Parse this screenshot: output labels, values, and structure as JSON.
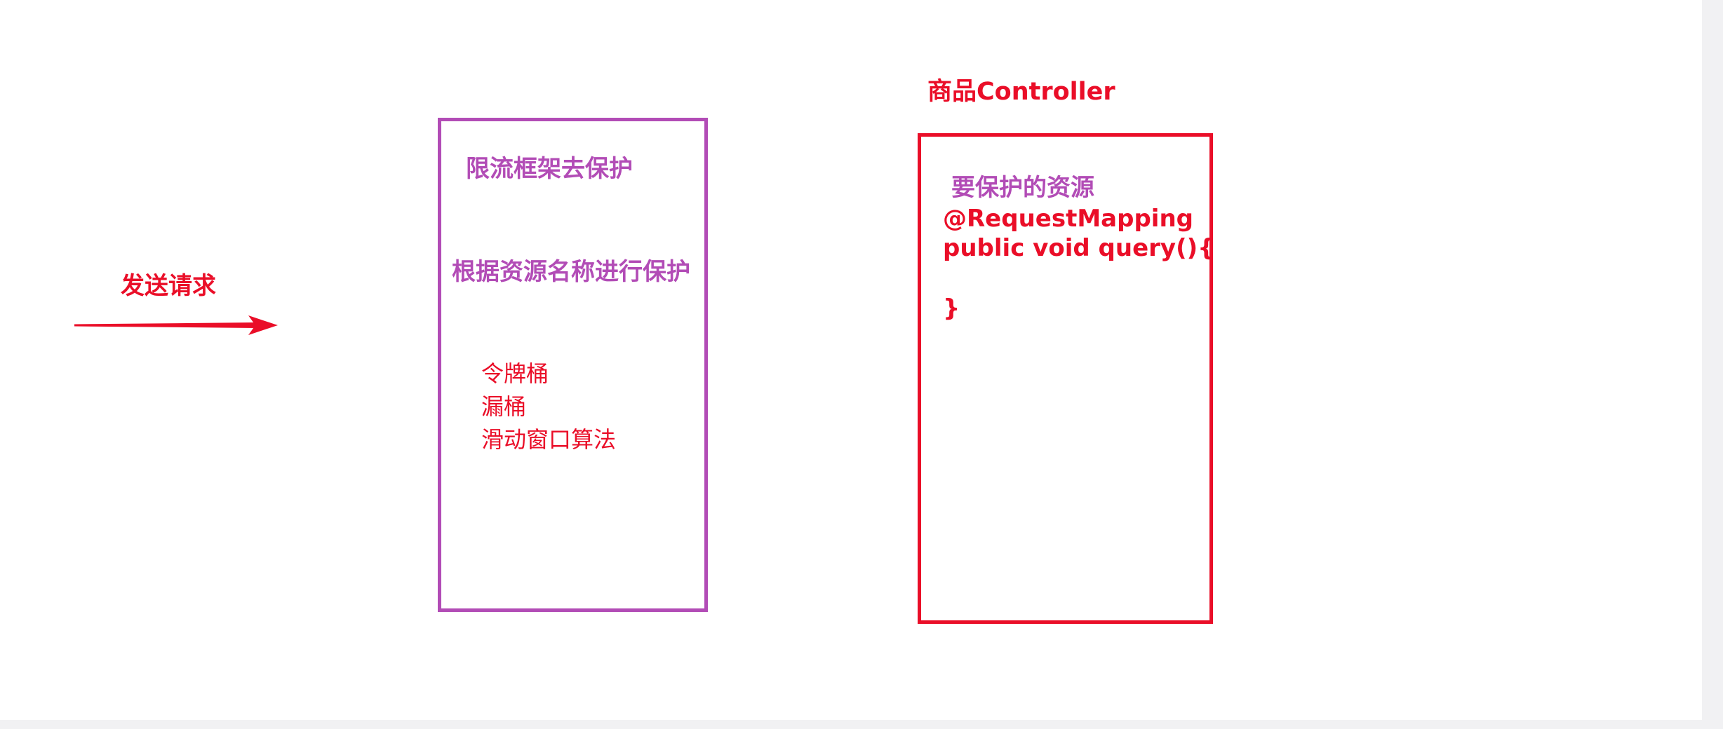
{
  "send_label": "发送请求",
  "limiter": {
    "title": "限流框架去保护",
    "subtitle": "根据资源名称进行保护",
    "algorithms": [
      "令牌桶",
      "漏桶",
      "滑动窗口算法"
    ]
  },
  "controller": {
    "title": "商品Controller",
    "resource_label": "要保护的资源",
    "code_lines": [
      "@RequestMapping",
      "public void query(){",
      "}"
    ]
  },
  "colors": {
    "red": "#ea0e28",
    "purple": "#b24cb6"
  }
}
